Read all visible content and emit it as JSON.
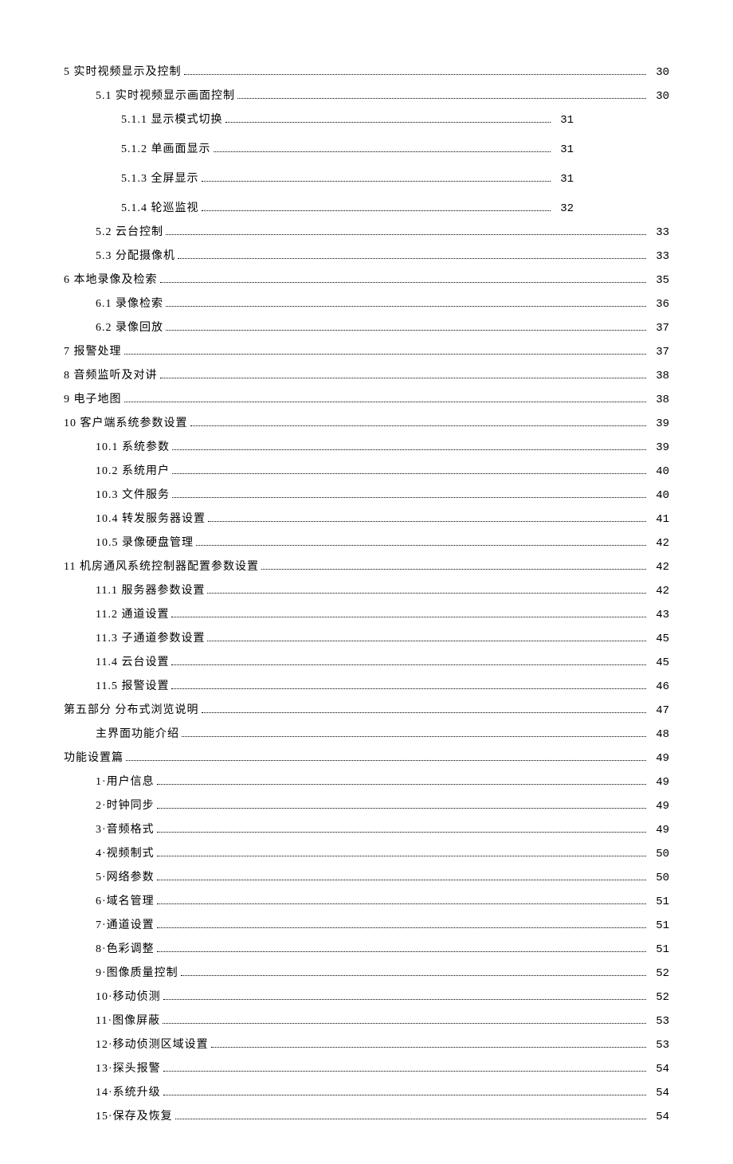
{
  "toc": [
    {
      "level": 0,
      "label": "5 实时视频显示及控制 ",
      "page": "30"
    },
    {
      "level": 1,
      "label": "5.1 实时视频显示画面控制",
      "page": "30"
    },
    {
      "level": 2,
      "label": "5.1.1 显示模式切换",
      "page": "31",
      "spaced": true
    },
    {
      "level": 2,
      "label": "5.1.2 单画面显示",
      "page": "31",
      "spaced": true
    },
    {
      "level": 2,
      "label": "5.1.3 全屏显示",
      "page": "31",
      "spaced": true
    },
    {
      "level": 2,
      "label": "5.1.4 轮巡监视",
      "page": "32"
    },
    {
      "level": 1,
      "label": "5.2 云台控制",
      "page": "33"
    },
    {
      "level": 1,
      "label": "5.3 分配摄像机 ",
      "page": "33"
    },
    {
      "level": 0,
      "label": "6 本地录像及检索 ",
      "page": "35"
    },
    {
      "level": 1,
      "label": "6.1 录像检索 ",
      "page": "36"
    },
    {
      "level": 1,
      "label": "6.2 录像回放 ",
      "page": "37"
    },
    {
      "level": 0,
      "label": "7 报警处理 ",
      "page": "37"
    },
    {
      "level": 0,
      "label": "8 音频监听及对讲 ",
      "page": "38"
    },
    {
      "level": 0,
      "label": "9 电子地图 ",
      "page": "38"
    },
    {
      "level": 0,
      "label": "10 客户端系统参数设置 ",
      "page": "39"
    },
    {
      "level": 1,
      "label": "10.1 系统参数 ",
      "page": "39"
    },
    {
      "level": 1,
      "label": "10.2 系统用户 ",
      "page": "40"
    },
    {
      "level": 1,
      "label": "10.3 文件服务 ",
      "page": "40"
    },
    {
      "level": 1,
      "label": "10.4 转发服务器设置 ",
      "page": "41"
    },
    {
      "level": 1,
      "label": "10.5 录像硬盘管理 ",
      "page": "42"
    },
    {
      "level": 0,
      "label": "11 机房通风系统控制器配置参数设置 ",
      "page": "42"
    },
    {
      "level": 1,
      "label": "11.1 服务器参数设置 ",
      "page": "42"
    },
    {
      "level": 1,
      "label": "11.2 通道设置 ",
      "page": "43"
    },
    {
      "level": 1,
      "label": "11.3 子通道参数设置 ",
      "page": "45"
    },
    {
      "level": 1,
      "label": "11.4 云台设置 ",
      "page": "45"
    },
    {
      "level": 1,
      "label": "11.5 报警设置 ",
      "page": "46"
    },
    {
      "level": 0,
      "label": "第五部分  分布式浏览说明",
      "page": "47"
    },
    {
      "level": 1,
      "label": "主界面功能介绍",
      "page": "48"
    },
    {
      "level": 0,
      "label": "功能设置篇",
      "page": "49"
    },
    {
      "level": 1,
      "label": "1·用户信息",
      "page": "49"
    },
    {
      "level": 1,
      "label": "2·时钟同步",
      "page": "49"
    },
    {
      "level": 1,
      "label": "3·音频格式",
      "page": "49"
    },
    {
      "level": 1,
      "label": "4·视频制式",
      "page": "50"
    },
    {
      "level": 1,
      "label": "5·网络参数",
      "page": "50"
    },
    {
      "level": 1,
      "label": "6·域名管理",
      "page": "51"
    },
    {
      "level": 1,
      "label": "7·通道设置",
      "page": "51"
    },
    {
      "level": 1,
      "label": "8·色彩调整",
      "page": "51"
    },
    {
      "level": 1,
      "label": "9·图像质量控制",
      "page": "52"
    },
    {
      "level": 1,
      "label": "10·移动侦测",
      "page": "52"
    },
    {
      "level": 1,
      "label": "11·图像屏蔽",
      "page": "53"
    },
    {
      "level": 1,
      "label": "12·移动侦测区域设置",
      "page": "53"
    },
    {
      "level": 1,
      "label": "13·探头报警",
      "page": "54"
    },
    {
      "level": 1,
      "label": "14·系统升级",
      "page": "54"
    },
    {
      "level": 1,
      "label": "15·保存及恢复",
      "page": "54"
    }
  ]
}
